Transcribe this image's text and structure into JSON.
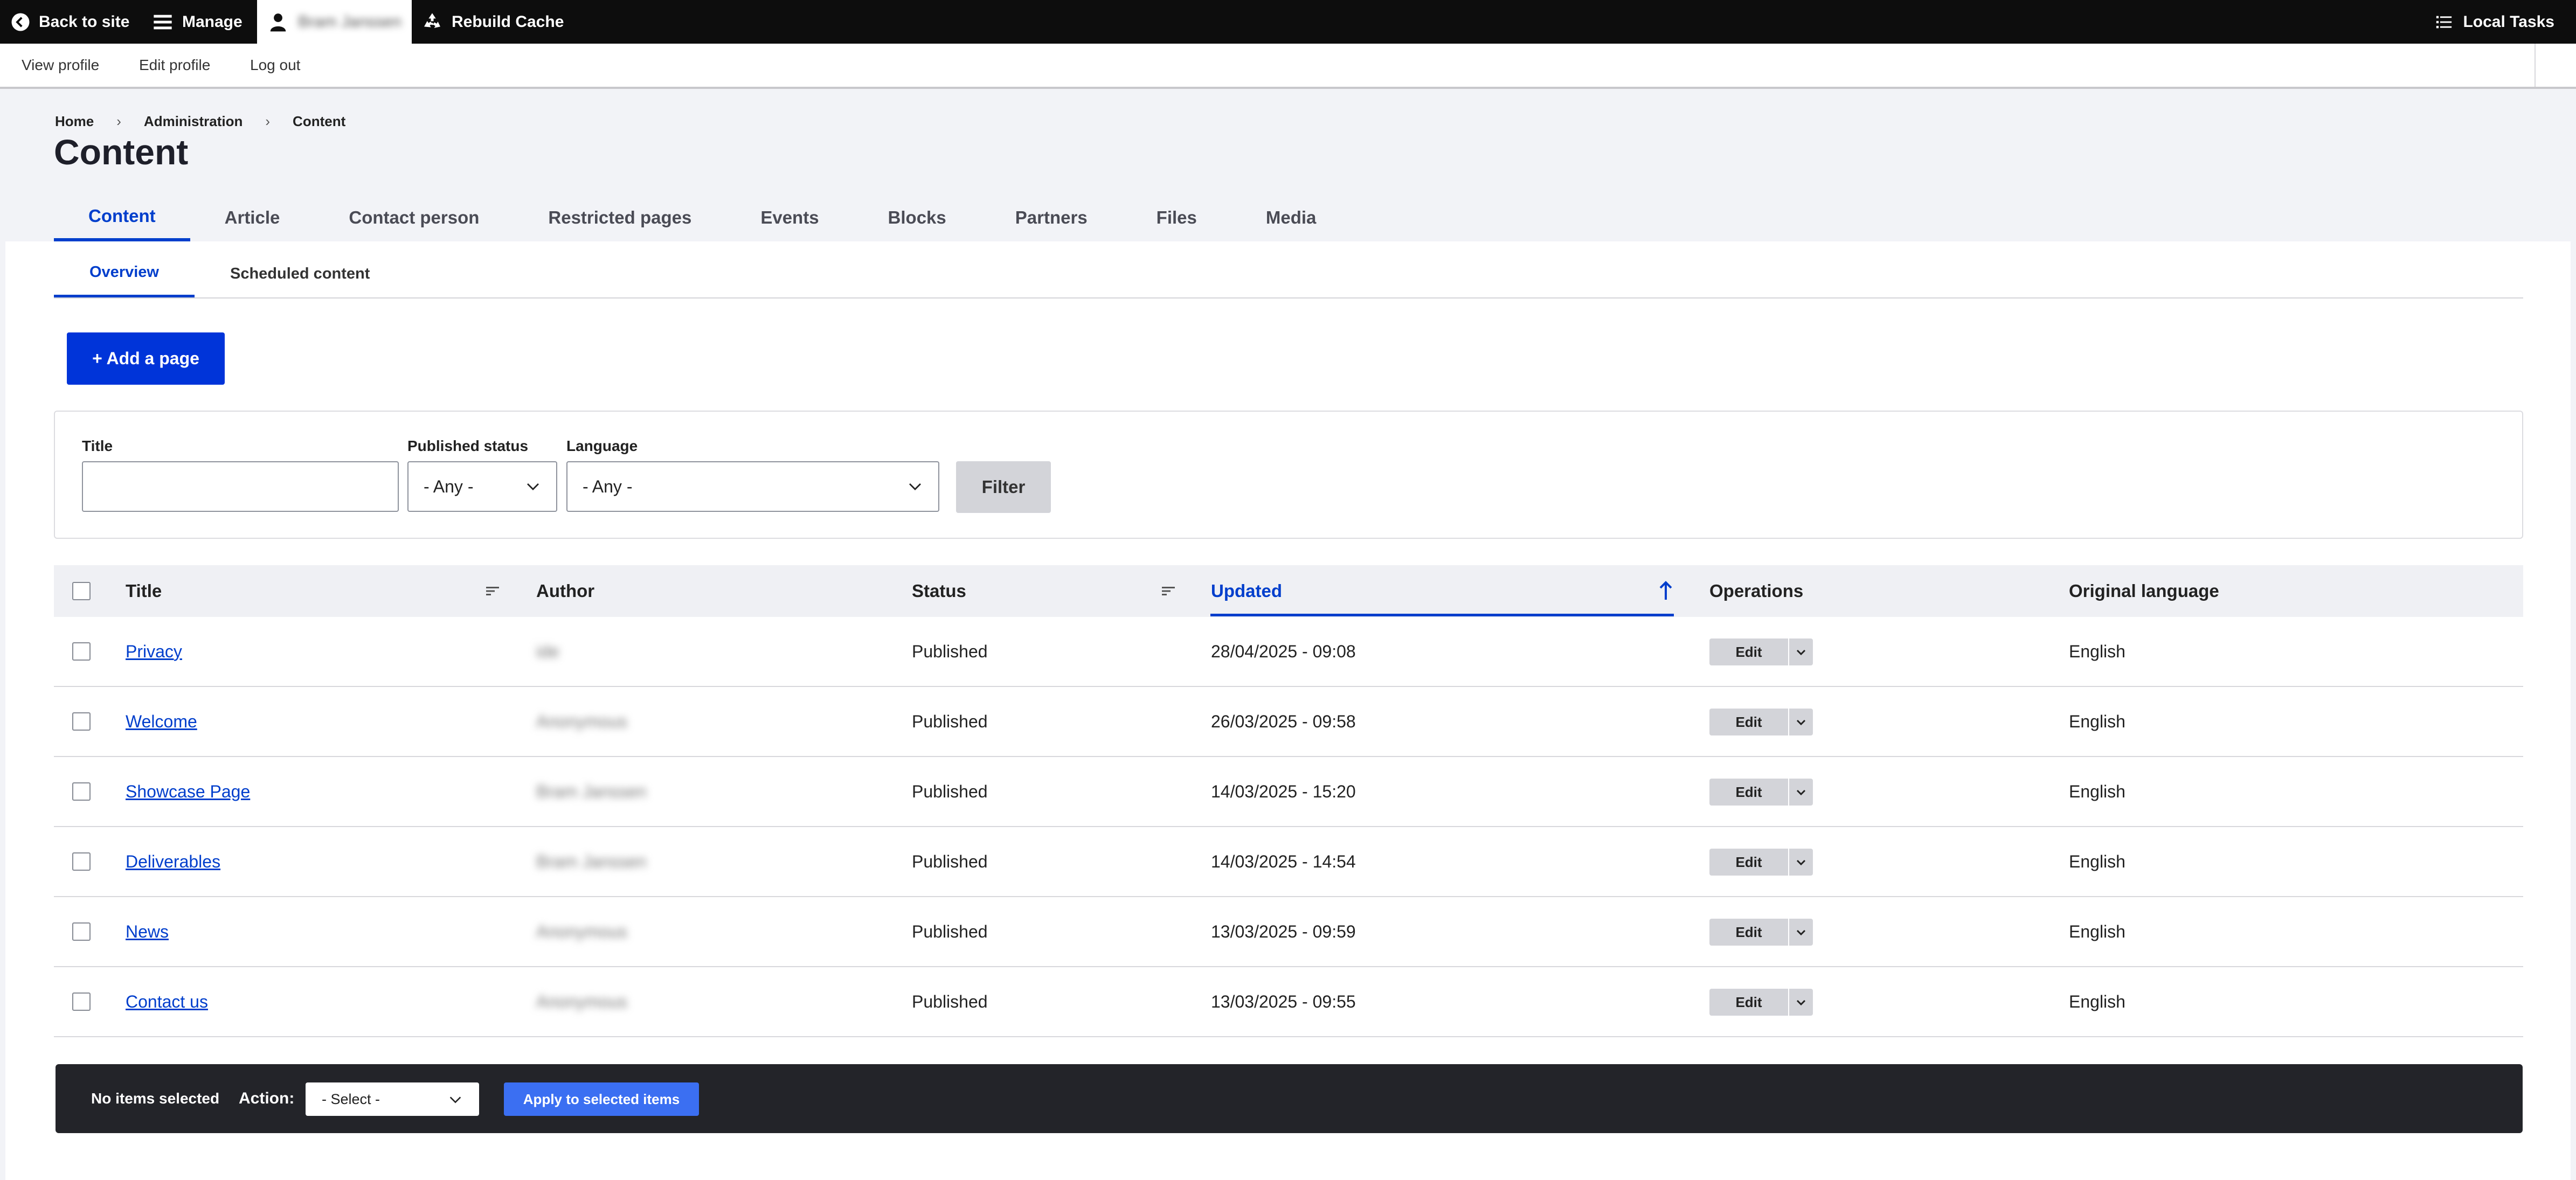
{
  "toolbar": {
    "back_label": "Back to site",
    "manage_label": "Manage",
    "user_name": "Bram Janssen",
    "rebuild_label": "Rebuild Cache",
    "tasks_label": "Local Tasks"
  },
  "tray": {
    "view_profile": "View profile",
    "edit_profile": "Edit profile",
    "logout": "Log out"
  },
  "breadcrumb": [
    "Home",
    "Administration",
    "Content"
  ],
  "breadcrumb_separator": "›",
  "page_title": "Content",
  "primary_tabs": [
    "Content",
    "Article",
    "Contact person",
    "Restricted pages",
    "Events",
    "Blocks",
    "Partners",
    "Files",
    "Media"
  ],
  "secondary_tabs": [
    "Overview",
    "Scheduled content"
  ],
  "add_button": "+ Add a page",
  "filter": {
    "title_label": "Title",
    "title_value": "",
    "status_label": "Published status",
    "status_value": "- Any -",
    "language_label": "Language",
    "language_value": "- Any -",
    "button": "Filter"
  },
  "table": {
    "headers": {
      "title": "Title",
      "author": "Author",
      "status": "Status",
      "updated": "Updated",
      "operations": "Operations",
      "language": "Original language"
    },
    "sorted_column": "updated",
    "rows": [
      {
        "title": "Privacy",
        "author": "ide",
        "status": "Published",
        "updated": "28/04/2025 - 09:08",
        "language": "English"
      },
      {
        "title": "Welcome",
        "author": "Anonymous",
        "status": "Published",
        "updated": "26/03/2025 - 09:58",
        "language": "English"
      },
      {
        "title": "Showcase Page",
        "author": "Bram Janssen",
        "status": "Published",
        "updated": "14/03/2025 - 15:20",
        "language": "English"
      },
      {
        "title": "Deliverables",
        "author": "Bram Janssen",
        "status": "Published",
        "updated": "14/03/2025 - 14:54",
        "language": "English"
      },
      {
        "title": "News",
        "author": "Anonymous",
        "status": "Published",
        "updated": "13/03/2025 - 09:59",
        "language": "English"
      },
      {
        "title": "Contact us",
        "author": "Anonymous",
        "status": "Published",
        "updated": "13/03/2025 - 09:55",
        "language": "English"
      }
    ],
    "edit_label": "Edit"
  },
  "bulk": {
    "count_text": "No items selected",
    "action_label": "Action:",
    "select_value": "- Select -",
    "apply_label": "Apply to selected items"
  },
  "colors": {
    "accent": "#003ecc",
    "primary_button": "#0034d9",
    "toolbar_bg": "#0d0d0d",
    "bulk_bg": "#232429"
  }
}
